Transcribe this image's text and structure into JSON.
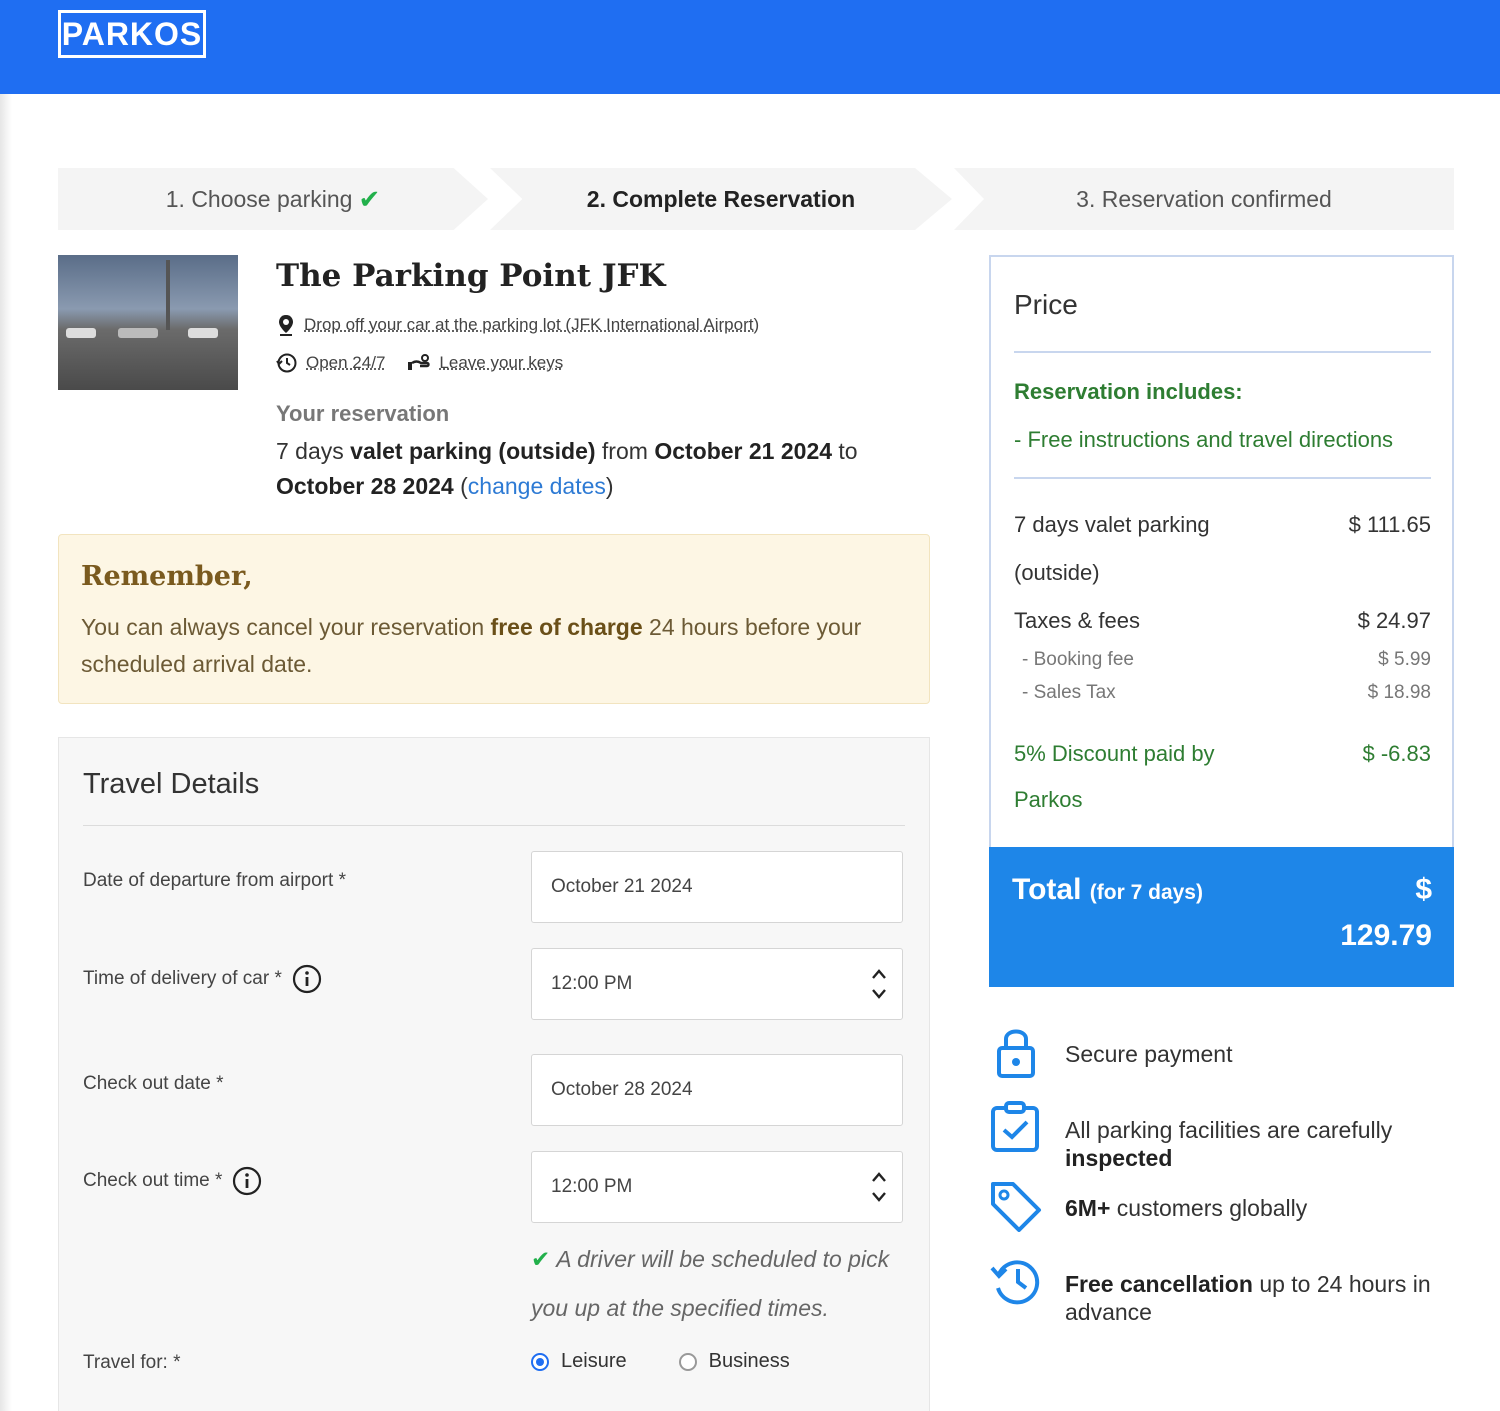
{
  "header": {
    "logo": "PARKOS",
    "brand_color": "#1f6ef2"
  },
  "steps": [
    {
      "label": "1. Choose parking",
      "done": true
    },
    {
      "label": "2. Complete Reservation",
      "active": true
    },
    {
      "label": "3. Reservation confirmed"
    }
  ],
  "lot": {
    "name": "The Parking Point JFK",
    "location": "Drop off your car at the parking lot (JFK International Airport)",
    "hours": "Open 24/7",
    "keys": "Leave your keys"
  },
  "reservation": {
    "label": "Your reservation",
    "days": "7 days",
    "type": "valet parking (outside)",
    "from_word": "from",
    "start": "October 21 2024",
    "to_word": "to",
    "end": "October 28 2024",
    "change": "change dates"
  },
  "remember": {
    "title": "Remember,",
    "text_before": "You can always cancel your reservation",
    "text_bold": "free of charge",
    "text_after": "24 hours before your scheduled arrival date."
  },
  "travel": {
    "title": "Travel Details",
    "departure_label": "Date of departure from airport *",
    "departure_value": "October 21 2024",
    "delivery_label": "Time of delivery of car *",
    "delivery_value": "12:00 PM",
    "checkout_date_label": "Check out date *",
    "checkout_date_value": "October 28 2024",
    "checkout_time_label": "Check out time *",
    "checkout_time_value": "12:00 PM",
    "driver_note": "A driver will be scheduled to pick you up at the specified times.",
    "travel_for_label": "Travel for: *",
    "options": [
      "Leisure",
      "Business"
    ],
    "selected": "Leisure"
  },
  "price": {
    "title": "Price",
    "includes_title": "Reservation includes:",
    "includes_item": "- Free instructions and travel directions",
    "parking_label": "7 days valet parking (outside)",
    "parking_amount": "$ 111.65",
    "taxes_label": "Taxes & fees",
    "taxes_amount": "$ 24.97",
    "booking_label": "- Booking fee",
    "booking_amount": "$ 5.99",
    "sales_label": "- Sales Tax",
    "sales_amount": "$ 18.98",
    "discount_label": "5% Discount paid by Parkos",
    "discount_amount": "$ -6.83",
    "total_label": "Total",
    "total_sub": "(for 7 days)",
    "total_currency": "$",
    "total_value": "129.79"
  },
  "usps": {
    "secure": "Secure payment",
    "inspected_a": "All parking facilities are carefully",
    "inspected_b": "inspected",
    "customers_bold": "6M+",
    "customers_rest": "customers globally",
    "cancel_bold": "Free cancellation",
    "cancel_rest": "up to 24 hours in advance"
  }
}
